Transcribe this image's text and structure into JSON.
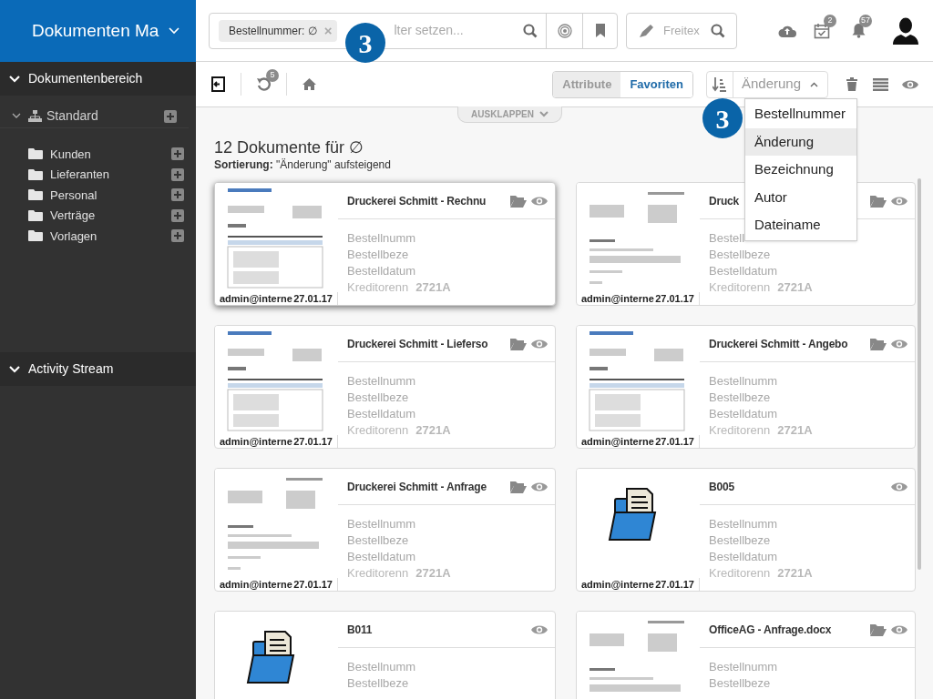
{
  "app_title": "Dokumenten Ma",
  "sidebar": {
    "sections": [
      {
        "label": "Dokumentenbereich",
        "expanded": true
      },
      {
        "label": "Activity Stream",
        "expanded": true
      }
    ],
    "tree": {
      "label": "Standard",
      "expanded": true,
      "children": [
        {
          "label": "Kunden"
        },
        {
          "label": "Lieferanten"
        },
        {
          "label": "Personal"
        },
        {
          "label": "Verträge"
        },
        {
          "label": "Vorlagen"
        }
      ]
    }
  },
  "filter": {
    "chip": "Bestellnummer: ∅",
    "chip_close": "×",
    "placeholder": "lter setzen..."
  },
  "freetext": {
    "placeholder": "Freitex"
  },
  "header_badges": {
    "tasks": "2",
    "notifications": "57"
  },
  "toolbar": {
    "undo_count": "5",
    "view_tabs": [
      {
        "label": "Attribute",
        "selected": false
      },
      {
        "label": "Favoriten",
        "selected": true
      }
    ],
    "sort": {
      "value": "Änderung",
      "expanded": true,
      "options": [
        {
          "label": "Bestellnummer",
          "selected": false
        },
        {
          "label": "Änderung",
          "selected": true
        },
        {
          "label": "Bezeichnung",
          "selected": false
        },
        {
          "label": "Autor",
          "selected": false
        },
        {
          "label": "Dateiname",
          "selected": false
        }
      ]
    }
  },
  "expand_button": "AUSKLAPPEN",
  "heading": "12 Dokumente für ∅",
  "sort_note": "**Sortierung:** \"Änderung\" aufsteigend",
  "cards": [
    {
      "title": "Druckerei Schmitt - Rechnu",
      "kind": "invoice",
      "in_folder": true,
      "selected": true,
      "author": "admin@interne",
      "date": "27.01.17",
      "fields": [
        "Bestellnumm",
        "Bestellbeze",
        "Bestelldatum"
      ],
      "creditor": {
        "label": "Kreditorenn",
        "value": "2721A"
      }
    },
    {
      "title": "Druck",
      "kind": "letter",
      "in_folder": true,
      "selected": false,
      "author": "admin@interne",
      "date": "27.01.17",
      "fields": [
        "Bestell",
        "Bestellbeze",
        "Bestelldatum"
      ],
      "creditor": {
        "label": "Kreditorenn",
        "value": "2721A"
      }
    },
    {
      "title": "Druckerei Schmitt - Lieferso",
      "kind": "invoice",
      "in_folder": true,
      "selected": false,
      "author": "admin@interne",
      "date": "27.01.17",
      "fields": [
        "Bestellnumm",
        "Bestellbeze",
        "Bestelldatum"
      ],
      "creditor": {
        "label": "Kreditorenn",
        "value": "2721A"
      }
    },
    {
      "title": "Druckerei Schmitt - Angebo",
      "kind": "invoice",
      "in_folder": true,
      "selected": false,
      "author": "admin@interne",
      "date": "27.01.17",
      "fields": [
        "Bestellnumm",
        "Bestellbeze",
        "Bestelldatum"
      ],
      "creditor": {
        "label": "Kreditorenn",
        "value": "2721A"
      }
    },
    {
      "title": "Druckerei Schmitt - Anfrage",
      "kind": "letter",
      "in_folder": true,
      "selected": false,
      "author": "admin@interne",
      "date": "27.01.17",
      "fields": [
        "Bestellnumm",
        "Bestellbeze",
        "Bestelldatum"
      ],
      "creditor": {
        "label": "Kreditorenn",
        "value": "2721A"
      }
    },
    {
      "title": "B005",
      "kind": "folder",
      "in_folder": false,
      "selected": false,
      "author": "admin@interne",
      "date": "27.01.17",
      "fields": [
        "Bestellnumm",
        "Bestellbeze",
        "Bestelldatum"
      ],
      "creditor": {
        "label": "Kreditorenn",
        "value": "2721A"
      }
    },
    {
      "title": "B011",
      "kind": "folder",
      "in_folder": false,
      "selected": false,
      "fields": [
        "Bestellnumm",
        "Bestellbeze"
      ]
    },
    {
      "title": "OfficeAG - Anfrage.docx",
      "kind": "letter",
      "in_folder": true,
      "selected": false,
      "fields": [
        "Bestellnumm",
        "Bestellbeze"
      ]
    }
  ],
  "annotations": [
    {
      "label": "3"
    },
    {
      "label": "3"
    }
  ]
}
